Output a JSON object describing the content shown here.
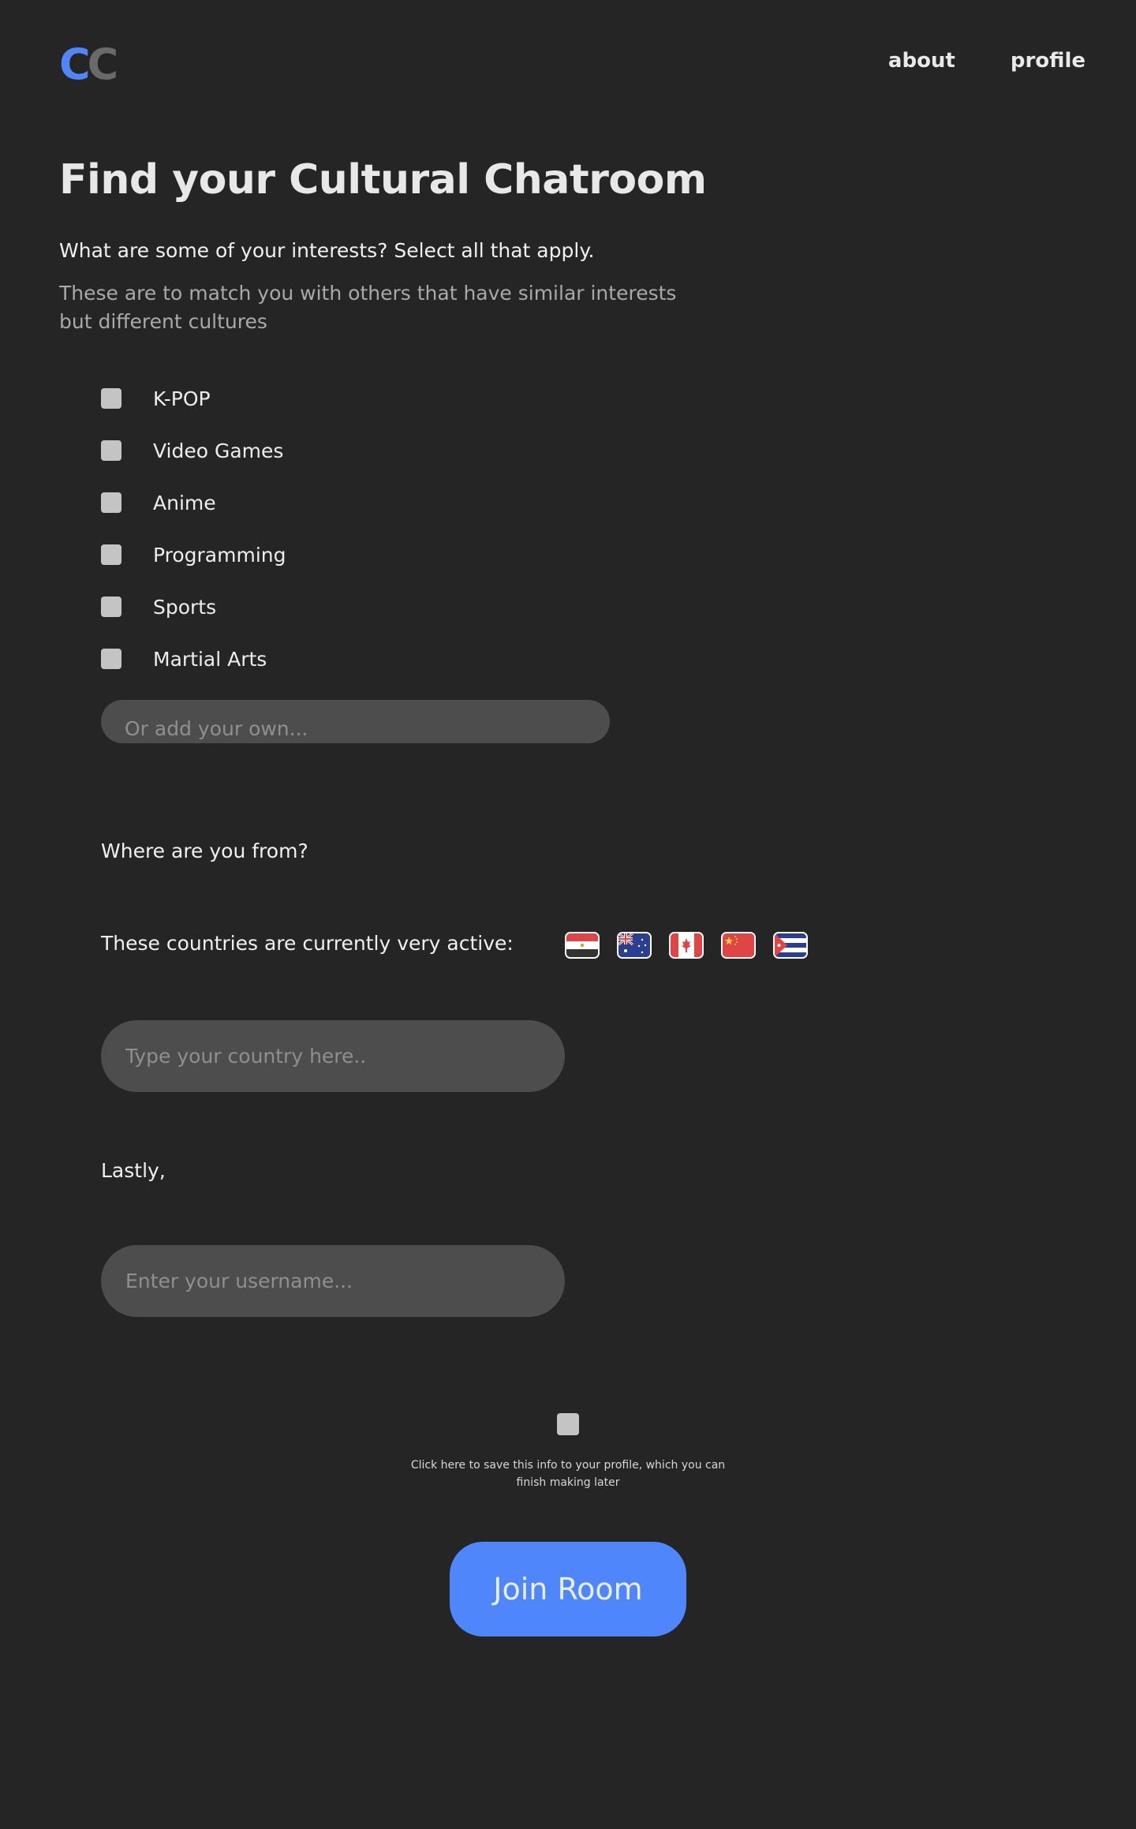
{
  "colors": {
    "accent": "#5086fb",
    "background": "#252525",
    "input_bg": "#4d4d4d",
    "checkbox": "#c4c4c4"
  },
  "header": {
    "logo_c1": "C",
    "logo_c2": "C",
    "nav": {
      "about": "about",
      "profile": "profile"
    }
  },
  "main": {
    "title": "Find your Cultural Chatroom",
    "interests_question": "What are some of your interests? Select all that apply.",
    "interests_subtext": "These are to match you with others that have similar interests but different cultures",
    "interests": [
      {
        "label": "K-POP",
        "checked": false
      },
      {
        "label": "Video Games",
        "checked": false
      },
      {
        "label": "Anime",
        "checked": false
      },
      {
        "label": "Programming",
        "checked": false
      },
      {
        "label": "Sports",
        "checked": false
      },
      {
        "label": "Martial Arts",
        "checked": false
      }
    ],
    "add_own_placeholder": "Or add your own...",
    "where_question": "Where are you from?",
    "active_countries_label": "These countries are currently very active:",
    "active_flags": [
      "egypt-flag-icon",
      "australia-flag-icon",
      "canada-flag-icon",
      "china-flag-icon",
      "cuba-flag-icon"
    ],
    "country_placeholder": "Type your country here..",
    "lastly_label": "Lastly,",
    "username_placeholder": "Enter your username...",
    "save_text": "Click here to save this info to your profile, which you can finish making later",
    "join_button": "Join Room"
  }
}
